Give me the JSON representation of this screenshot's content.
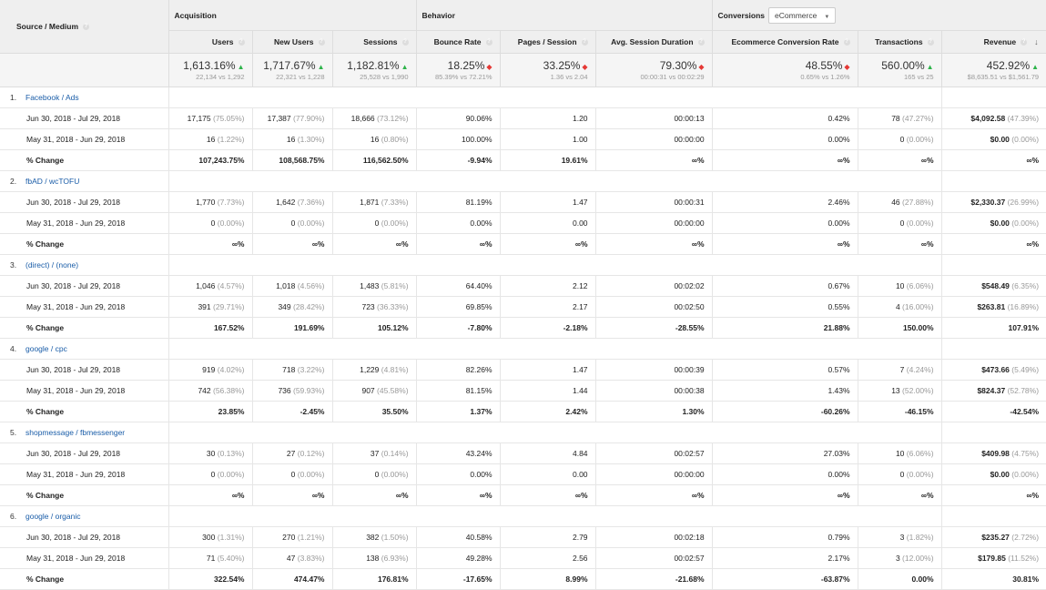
{
  "header": {
    "source_medium": "Source / Medium",
    "acquisition": "Acquisition",
    "behavior": "Behavior",
    "conversions": "Conversions",
    "conversions_select": "eCommerce",
    "columns": [
      "Users",
      "New Users",
      "Sessions",
      "Bounce Rate",
      "Pages / Session",
      "Avg. Session Duration",
      "Ecommerce Conversion Rate",
      "Transactions",
      "Revenue"
    ]
  },
  "summary": [
    {
      "value": "1,613.16%",
      "dir": "up",
      "compare": "22,134 vs 1,292"
    },
    {
      "value": "1,717.67%",
      "dir": "up",
      "compare": "22,321 vs 1,228"
    },
    {
      "value": "1,182.81%",
      "dir": "up",
      "compare": "25,528 vs 1,990"
    },
    {
      "value": "18.25%",
      "dir": "down",
      "compare": "85.39% vs 72.21%"
    },
    {
      "value": "33.25%",
      "dir": "down",
      "compare": "1.36 vs 2.04"
    },
    {
      "value": "79.30%",
      "dir": "down",
      "compare": "00:00:31 vs 00:02:29"
    },
    {
      "value": "48.55%",
      "dir": "down",
      "compare": "0.65% vs 1.26%"
    },
    {
      "value": "560.00%",
      "dir": "up",
      "compare": "165 vs 25"
    },
    {
      "value": "452.92%",
      "dir": "up",
      "compare": "$8,635.51 vs $1,561.79"
    }
  ],
  "row_labels": {
    "current": "Jun 30, 2018 - Jul 29, 2018",
    "previous": "May 31, 2018 - Jun 29, 2018",
    "change": "% Change"
  },
  "sources": [
    {
      "index": "1.",
      "name": "Facebook / Ads",
      "current": [
        [
          "17,175",
          "(75.05%)"
        ],
        [
          "17,387",
          "(77.90%)"
        ],
        [
          "18,666",
          "(73.12%)"
        ],
        [
          "90.06%",
          ""
        ],
        [
          "1.20",
          ""
        ],
        [
          "00:00:13",
          ""
        ],
        [
          "0.42%",
          ""
        ],
        [
          "78",
          "(47.27%)"
        ],
        [
          "$4,092.58",
          "(47.39%)"
        ]
      ],
      "previous": [
        [
          "16",
          "(1.22%)"
        ],
        [
          "16",
          "(1.30%)"
        ],
        [
          "16",
          "(0.80%)"
        ],
        [
          "100.00%",
          ""
        ],
        [
          "1.00",
          ""
        ],
        [
          "00:00:00",
          ""
        ],
        [
          "0.00%",
          ""
        ],
        [
          "0",
          "(0.00%)"
        ],
        [
          "$0.00",
          "(0.00%)"
        ]
      ],
      "change": [
        "107,243.75%",
        "108,568.75%",
        "116,562.50%",
        "-9.94%",
        "19.61%",
        "∞%",
        "∞%",
        "∞%",
        "∞%"
      ]
    },
    {
      "index": "2.",
      "name": "fbAD / wcTOFU",
      "current": [
        [
          "1,770",
          "(7.73%)"
        ],
        [
          "1,642",
          "(7.36%)"
        ],
        [
          "1,871",
          "(7.33%)"
        ],
        [
          "81.19%",
          ""
        ],
        [
          "1.47",
          ""
        ],
        [
          "00:00:31",
          ""
        ],
        [
          "2.46%",
          ""
        ],
        [
          "46",
          "(27.88%)"
        ],
        [
          "$2,330.37",
          "(26.99%)"
        ]
      ],
      "previous": [
        [
          "0",
          "(0.00%)"
        ],
        [
          "0",
          "(0.00%)"
        ],
        [
          "0",
          "(0.00%)"
        ],
        [
          "0.00%",
          ""
        ],
        [
          "0.00",
          ""
        ],
        [
          "00:00:00",
          ""
        ],
        [
          "0.00%",
          ""
        ],
        [
          "0",
          "(0.00%)"
        ],
        [
          "$0.00",
          "(0.00%)"
        ]
      ],
      "change": [
        "∞%",
        "∞%",
        "∞%",
        "∞%",
        "∞%",
        "∞%",
        "∞%",
        "∞%",
        "∞%"
      ]
    },
    {
      "index": "3.",
      "name": "(direct) / (none)",
      "current": [
        [
          "1,046",
          "(4.57%)"
        ],
        [
          "1,018",
          "(4.56%)"
        ],
        [
          "1,483",
          "(5.81%)"
        ],
        [
          "64.40%",
          ""
        ],
        [
          "2.12",
          ""
        ],
        [
          "00:02:02",
          ""
        ],
        [
          "0.67%",
          ""
        ],
        [
          "10",
          "(6.06%)"
        ],
        [
          "$548.49",
          "(6.35%)"
        ]
      ],
      "previous": [
        [
          "391",
          "(29.71%)"
        ],
        [
          "349",
          "(28.42%)"
        ],
        [
          "723",
          "(36.33%)"
        ],
        [
          "69.85%",
          ""
        ],
        [
          "2.17",
          ""
        ],
        [
          "00:02:50",
          ""
        ],
        [
          "0.55%",
          ""
        ],
        [
          "4",
          "(16.00%)"
        ],
        [
          "$263.81",
          "(16.89%)"
        ]
      ],
      "change": [
        "167.52%",
        "191.69%",
        "105.12%",
        "-7.80%",
        "-2.18%",
        "-28.55%",
        "21.88%",
        "150.00%",
        "107.91%"
      ]
    },
    {
      "index": "4.",
      "name": "google / cpc",
      "current": [
        [
          "919",
          "(4.02%)"
        ],
        [
          "718",
          "(3.22%)"
        ],
        [
          "1,229",
          "(4.81%)"
        ],
        [
          "82.26%",
          ""
        ],
        [
          "1.47",
          ""
        ],
        [
          "00:00:39",
          ""
        ],
        [
          "0.57%",
          ""
        ],
        [
          "7",
          "(4.24%)"
        ],
        [
          "$473.66",
          "(5.49%)"
        ]
      ],
      "previous": [
        [
          "742",
          "(56.38%)"
        ],
        [
          "736",
          "(59.93%)"
        ],
        [
          "907",
          "(45.58%)"
        ],
        [
          "81.15%",
          ""
        ],
        [
          "1.44",
          ""
        ],
        [
          "00:00:38",
          ""
        ],
        [
          "1.43%",
          ""
        ],
        [
          "13",
          "(52.00%)"
        ],
        [
          "$824.37",
          "(52.78%)"
        ]
      ],
      "change": [
        "23.85%",
        "-2.45%",
        "35.50%",
        "1.37%",
        "2.42%",
        "1.30%",
        "-60.26%",
        "-46.15%",
        "-42.54%"
      ]
    },
    {
      "index": "5.",
      "name": "shopmessage / fbmessenger",
      "current": [
        [
          "30",
          "(0.13%)"
        ],
        [
          "27",
          "(0.12%)"
        ],
        [
          "37",
          "(0.14%)"
        ],
        [
          "43.24%",
          ""
        ],
        [
          "4.84",
          ""
        ],
        [
          "00:02:57",
          ""
        ],
        [
          "27.03%",
          ""
        ],
        [
          "10",
          "(6.06%)"
        ],
        [
          "$409.98",
          "(4.75%)"
        ]
      ],
      "previous": [
        [
          "0",
          "(0.00%)"
        ],
        [
          "0",
          "(0.00%)"
        ],
        [
          "0",
          "(0.00%)"
        ],
        [
          "0.00%",
          ""
        ],
        [
          "0.00",
          ""
        ],
        [
          "00:00:00",
          ""
        ],
        [
          "0.00%",
          ""
        ],
        [
          "0",
          "(0.00%)"
        ],
        [
          "$0.00",
          "(0.00%)"
        ]
      ],
      "change": [
        "∞%",
        "∞%",
        "∞%",
        "∞%",
        "∞%",
        "∞%",
        "∞%",
        "∞%",
        "∞%"
      ]
    },
    {
      "index": "6.",
      "name": "google / organic",
      "current": [
        [
          "300",
          "(1.31%)"
        ],
        [
          "270",
          "(1.21%)"
        ],
        [
          "382",
          "(1.50%)"
        ],
        [
          "40.58%",
          ""
        ],
        [
          "2.79",
          ""
        ],
        [
          "00:02:18",
          ""
        ],
        [
          "0.79%",
          ""
        ],
        [
          "3",
          "(1.82%)"
        ],
        [
          "$235.27",
          "(2.72%)"
        ]
      ],
      "previous": [
        [
          "71",
          "(5.40%)"
        ],
        [
          "47",
          "(3.83%)"
        ],
        [
          "138",
          "(6.93%)"
        ],
        [
          "49.28%",
          ""
        ],
        [
          "2.56",
          ""
        ],
        [
          "00:02:57",
          ""
        ],
        [
          "2.17%",
          ""
        ],
        [
          "3",
          "(12.00%)"
        ],
        [
          "$179.85",
          "(11.52%)"
        ]
      ],
      "change": [
        "322.54%",
        "474.47%",
        "176.81%",
        "-17.65%",
        "8.99%",
        "-21.68%",
        "-63.87%",
        "0.00%",
        "30.81%"
      ]
    }
  ]
}
